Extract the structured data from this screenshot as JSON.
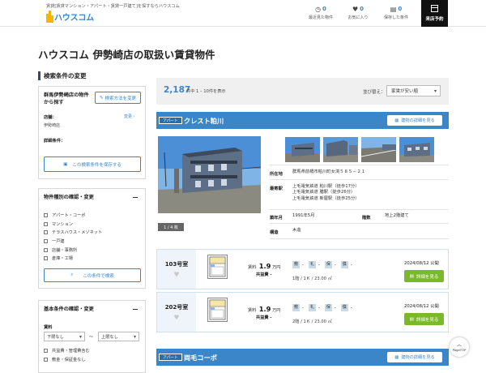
{
  "header": {
    "tagline": "賃貸[賃貸マンション・アパート・賃貸一戸建て]を探すならハウスコム",
    "logo_text": "ハウスコム",
    "nav": [
      {
        "count": "0",
        "label": "最近見た物件"
      },
      {
        "count": "0",
        "label": "お気に入り"
      },
      {
        "count": "0",
        "label": "保存した条件"
      }
    ],
    "visit_label": "来店予約"
  },
  "page_title": "ハウスコム 伊勢崎店の取扱い賃貸物件",
  "sidebar": {
    "change_heading": "検索条件の変更",
    "store_box": {
      "title_line1": "群馬伊勢崎店の物件",
      "title_line2": "から探す",
      "change_method_label": "検索方法を変更",
      "store_label": "店舗：",
      "store_change": "変更",
      "store_value": "伊勢崎店",
      "detail_label": "詳細条件：",
      "save_label": "この検索条件を保存する"
    },
    "type_box": {
      "title": "物件種別の確認・変更",
      "options": [
        "アパート・コーポ",
        "マンション",
        "テラスハウス・メゾネット",
        "一戸建",
        "店舗・事務所",
        "倉庫・工場"
      ],
      "apply_label": "この条件で検索"
    },
    "basic_box": {
      "title": "基本条件の確認・変更",
      "rent_label": "賃料",
      "rent_min": "下限なし",
      "rent_sep": "〜",
      "rent_max": "上限なし",
      "options": [
        "共益費・管理費含む",
        "敷金・保証金なし"
      ]
    }
  },
  "results": {
    "count": "2,187",
    "count_suffix": "件中 1 – 10件を表示",
    "sort_label": "並び替え：",
    "sort_value": "家賃が安い順"
  },
  "properties": [
    {
      "type": "アパート",
      "name": "クレスト粕川",
      "building_btn": "建物の詳細を見る",
      "photo_count": "1 / 4 枚",
      "info": {
        "address_label": "所在地",
        "address": "群馬県前橋市粕川町女渕５８５－２１",
        "station_label": "最寄駅",
        "stations": [
          "上毛電気鉄道 粕川駅（徒歩17分）",
          "上毛電気鉄道 膳駅（徒歩26分）",
          "上毛電気鉄道 新屋駅（徒歩25分）"
        ],
        "built_label": "築年月",
        "built": "1991年5月",
        "floors_label": "階数",
        "floors": "地上2階建て",
        "structure_label": "構造",
        "structure": "木造"
      },
      "rooms": [
        {
          "number": "103号室",
          "rent_label": "賃料",
          "rent": "1.9",
          "rent_unit": "万円",
          "common_fee": "共益費 -",
          "chips": [
            [
              "敷",
              "-"
            ],
            [
              "礼",
              "-"
            ],
            [
              "保",
              "-"
            ],
            [
              "償",
              "-"
            ]
          ],
          "layout": "1階 / 1Ｋ / 23.00 ㎡",
          "published": "2024/08/12 公開",
          "detail_btn": "詳細を見る"
        },
        {
          "number": "202号室",
          "rent_label": "賃料",
          "rent": "1.9",
          "rent_unit": "万円",
          "common_fee": "共益費 -",
          "chips": [
            [
              "敷",
              "-"
            ],
            [
              "礼",
              "-"
            ],
            [
              "保",
              "-"
            ],
            [
              "償",
              "-"
            ]
          ],
          "layout": "2階 / 1Ｋ / 23.00 ㎡",
          "published": "2024/08/12 公開",
          "detail_btn": "詳細を見る"
        }
      ]
    },
    {
      "type": "アパート",
      "name": "両毛コーポ",
      "building_btn": "建物の詳細を見る"
    }
  ],
  "page_top": "PageTOP",
  "colors": {
    "accent": "#3b86c9",
    "green": "#7aba2a",
    "dark": "#111111"
  }
}
